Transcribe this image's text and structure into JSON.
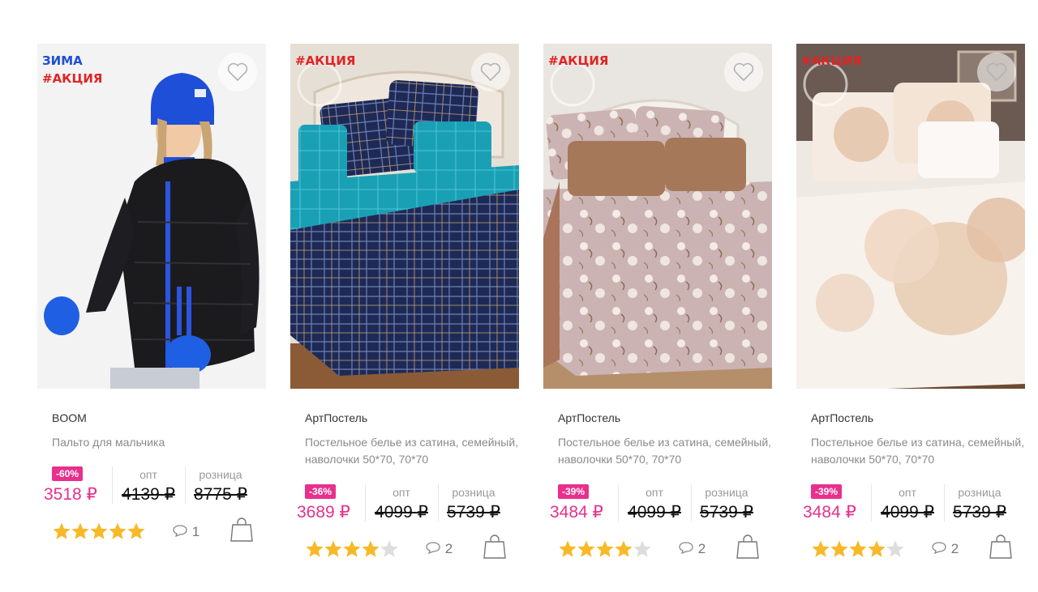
{
  "colors": {
    "accent": "#e8308c",
    "badge_red": "#e02424",
    "badge_blue": "#1b4fd6",
    "star_on": "#f7b928",
    "star_off": "#dddddd"
  },
  "products": [
    {
      "badges": [
        {
          "text": "ЗИМА",
          "color": "blue"
        },
        {
          "text": "#АКЦИЯ",
          "color": "red"
        }
      ],
      "brand": "BOOM",
      "title": "Пальто для мальчика",
      "discount": "-60%",
      "price": "3518 ₽",
      "opt_label": "опт",
      "opt_price": "4139 ₽",
      "retail_label": "розница",
      "retail_price": "8775 ₽",
      "rating": 5,
      "comments": "1",
      "image_kind": "coat"
    },
    {
      "badges": [
        {
          "text": "#АКЦИЯ",
          "color": "red"
        }
      ],
      "brand": "АртПостель",
      "title": "Постельное белье из сатина, семейный, наволочки 50*70, 70*70",
      "discount": "-36%",
      "price": "3689 ₽",
      "opt_label": "опт",
      "opt_price": "4099 ₽",
      "retail_label": "розница",
      "retail_price": "5739 ₽",
      "rating": 4,
      "comments": "2",
      "image_kind": "bed-navy"
    },
    {
      "badges": [
        {
          "text": "#АКЦИЯ",
          "color": "red"
        }
      ],
      "brand": "АртПостель",
      "title": "Постельное белье из сатина, семейный, наволочки 50*70, 70*70",
      "discount": "-39%",
      "price": "3484 ₽",
      "opt_label": "опт",
      "opt_price": "4099 ₽",
      "retail_label": "розница",
      "retail_price": "5739 ₽",
      "rating": 4,
      "comments": "2",
      "image_kind": "bed-pink"
    },
    {
      "badges": [
        {
          "text": "#АКЦИЯ",
          "color": "red"
        }
      ],
      "brand": "АртПостель",
      "title": "Постельное белье из сатина, семейный, наволочки 50*70, 70*70",
      "discount": "-39%",
      "price": "3484 ₽",
      "opt_label": "опт",
      "opt_price": "4099 ₽",
      "retail_label": "розница",
      "retail_price": "5739 ₽",
      "rating": 4,
      "comments": "2",
      "image_kind": "bed-roses"
    }
  ]
}
